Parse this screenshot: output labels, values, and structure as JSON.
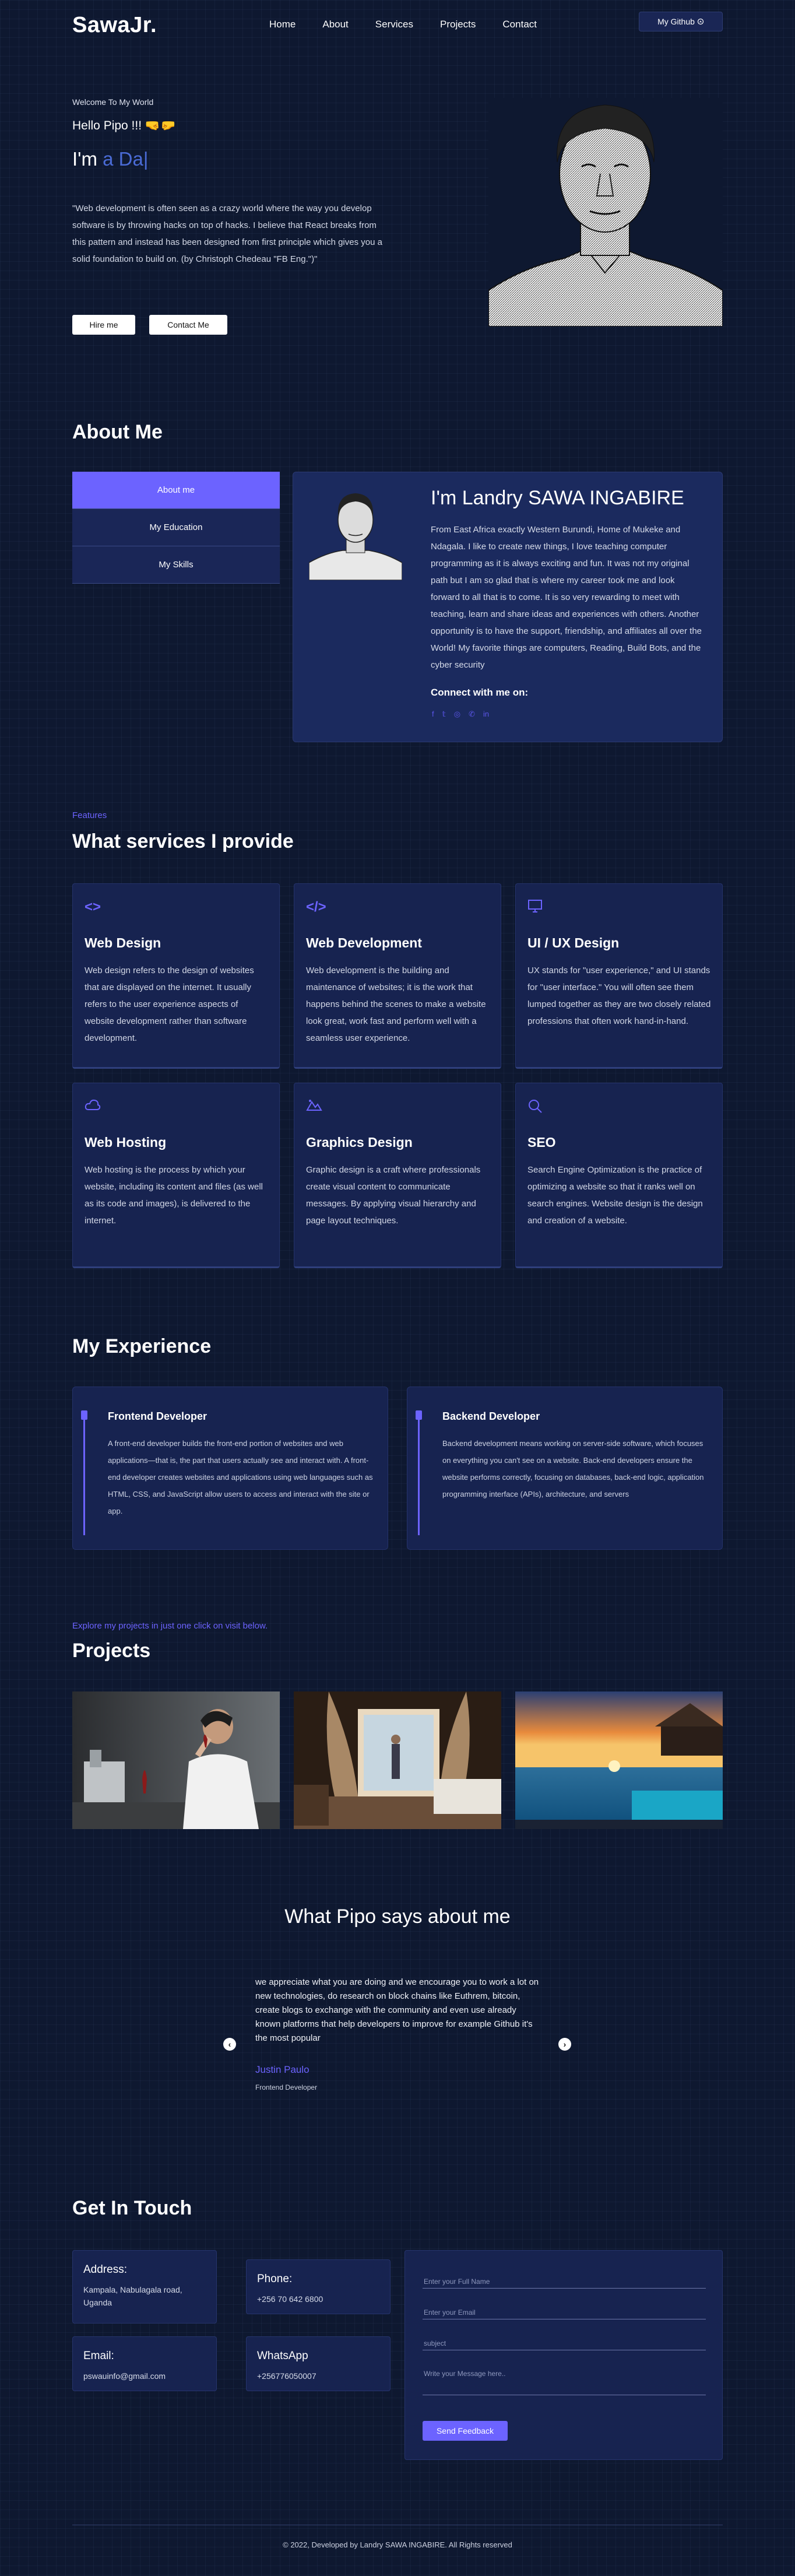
{
  "nav": {
    "logo": "SawaJr.",
    "links": [
      "Home",
      "About",
      "Services",
      "Projects",
      "Contact"
    ],
    "github_label": "My Github"
  },
  "hero": {
    "welcome": "Welcome To My World",
    "hello": "Hello Pipo !!! 🤜🤛",
    "im_prefix": "I'm ",
    "im_typed": "a Da|",
    "quote": "\"Web development is often seen as a crazy world where the way you develop software is by throwing hacks on top of hacks. I believe that React breaks from this pattern and instead has been designed from first principle which gives you a solid foundation to build on. (by Christoph Chedeau \"FB Eng.\")\"",
    "hire_label": "Hire me",
    "contact_label": "Contact Me"
  },
  "about": {
    "heading": "About Me",
    "tabs": [
      "About me",
      "My Education",
      "My Skills"
    ],
    "name": "I'm Landry SAWA INGABIRE",
    "text": "From East Africa exactly Western Burundi, Home of Mukeke and Ndagala. I like to create new things, I love teaching computer programming as it is always exciting and fun. It was not my original path but I am so glad that is where my career took me and look forward to all that is to come. It is so very rewarding to meet with teaching, learn and share ideas and experiences with others. Another opportunity is to have the support, friendship, and affiliates all over the World! My favorite things are computers, Reading, Build Bots, and the cyber security",
    "connect": "Connect with me on:",
    "social_icons": [
      "facebook-icon",
      "twitter-icon",
      "instagram-icon",
      "whatsapp-icon",
      "linkedin-icon"
    ]
  },
  "services": {
    "eyebrow": "Features",
    "heading": "What services I provide",
    "items": [
      {
        "icon": "code-brackets-icon",
        "title": "Web Design",
        "text": "Web design refers to the design of websites that are displayed on the internet. It usually refers to the user experience aspects of website development rather than software development."
      },
      {
        "icon": "code-slash-icon",
        "title": "Web Development",
        "text": "Web development is the building and maintenance of websites; it is the work that happens behind the scenes to make a website look great, work fast and perform well with a seamless user experience."
      },
      {
        "icon": "monitor-icon",
        "title": "UI / UX Design",
        "text": "UX stands for \"user experience,\" and UI stands for \"user interface.\" You will often see them lumped together as they are two closely related professions that often work hand-in-hand."
      },
      {
        "icon": "cloud-icon",
        "title": "Web Hosting",
        "text": "Web hosting is the process by which your website, including its content and files (as well as its code and images), is delivered to the internet."
      },
      {
        "icon": "mountain-icon",
        "title": "Graphics Design",
        "text": "Graphic design is a craft where professionals create visual content to communicate messages. By applying visual hierarchy and page layout techniques."
      },
      {
        "icon": "search-icon",
        "title": "SEO",
        "text": "Search Engine Optimization is the practice of optimizing a website so that it ranks well on search engines. Website design is the design and creation of a website."
      }
    ]
  },
  "experience": {
    "heading": "My Experience",
    "items": [
      {
        "title": "Frontend Developer",
        "text": "A front-end developer builds the front-end portion of websites and web applications—that is, the part that users actually see and interact with. A front-end developer creates websites and applications using web languages such as HTML, CSS, and JavaScript allow users to access and interact with the site or app."
      },
      {
        "title": "Backend Developer",
        "text": "Backend development means working on server-side software, which focuses on everything you can't see on a website. Back-end developers ensure the website performs correctly, focusing on databases, back-end logic, application programming interface (APIs), architecture, and servers"
      }
    ]
  },
  "projects": {
    "eyebrow": "Explore my projects in just one click on visit below.",
    "heading": "Projects"
  },
  "testimonial": {
    "heading": "What Pipo says about me",
    "text": "we appreciate what you are doing and we encourage you to work a lot on new technologies, do research on block chains like Euthrem, bitcoin, create blogs to exchange with the community and even use already known platforms that help developers to improve for example Github it's the most popular",
    "name": "Justin Paulo",
    "role": "Frontend Developer",
    "prev": "‹",
    "next": "›"
  },
  "contact": {
    "heading": "Get In Touch",
    "address_label": "Address:",
    "address_value": "Kampala, Nabulagala road, Uganda",
    "phone_label": "Phone:",
    "phone_value": "+256 70 642 6800",
    "email_label": "Email:",
    "email_value": "pswauinfo@gmail.com",
    "whatsapp_label": "WhatsApp",
    "whatsapp_value": "+256776050007",
    "form": {
      "name_placeholder": "Enter your Full Name",
      "email_placeholder": "Enter your Email",
      "subject_placeholder": "subject",
      "message_placeholder": "Write your Message here..",
      "send_label": "Send Feedback"
    }
  },
  "footer": {
    "text": "© 2022, Developed by Landry SAWA INGABIRE. All Rights reserved"
  },
  "colors": {
    "background": "#0e1830",
    "card": "#172350",
    "accent": "#6c63ff"
  }
}
